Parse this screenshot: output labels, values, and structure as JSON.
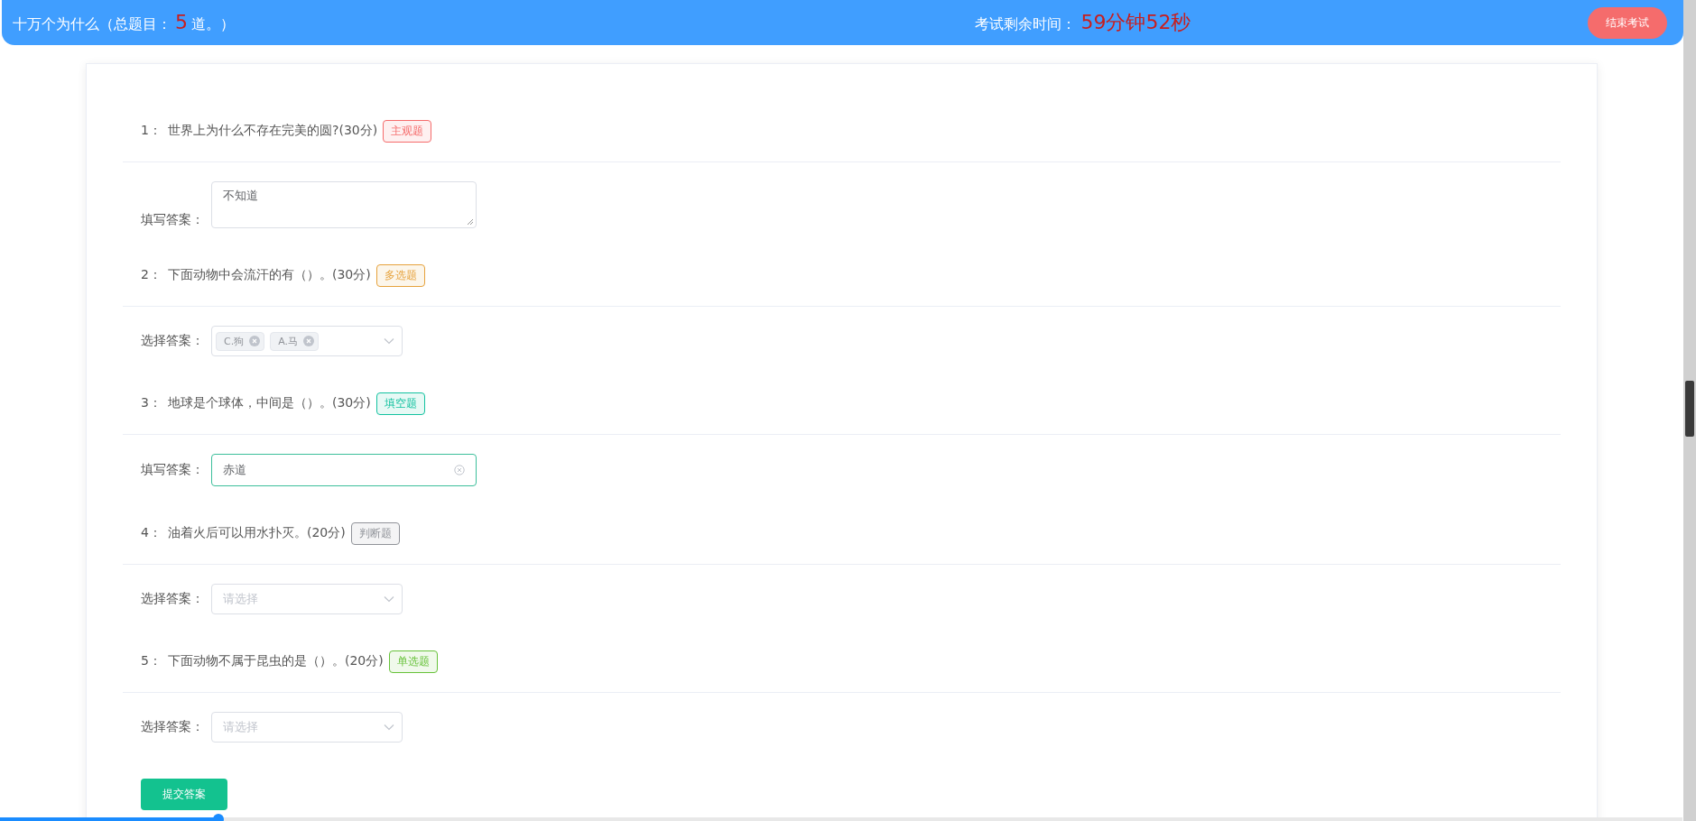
{
  "header": {
    "title_before": "十万个为什么（总题目：",
    "total": "5",
    "title_after": "道。）",
    "timer_label": "考试剩余时间：",
    "timer": "59分钟52秒",
    "end_button": "结束考试"
  },
  "questions": [
    {
      "number": "1：",
      "text": "世界上为什么不存在完美的圆?(30分)",
      "tag": {
        "label": "主观题",
        "color": "#f56c6c"
      },
      "answer": {
        "kind": "textarea",
        "label": "填写答案：",
        "value": "不知道",
        "focused": false
      }
    },
    {
      "number": "2：",
      "text": "下面动物中会流汗的有（）。(30分)",
      "tag": {
        "label": "多选题",
        "color": "#e6a23c"
      },
      "answer": {
        "kind": "multiselect",
        "label": "选择答案：",
        "chips": [
          "C.狗",
          "A.马"
        ],
        "focused": false
      }
    },
    {
      "number": "3：",
      "text": "地球是个球体，中间是（）。(30分)",
      "tag": {
        "label": "填空题",
        "color": "#13c2a0"
      },
      "answer": {
        "kind": "input",
        "label": "填写答案：",
        "value": "赤道",
        "focused": true
      }
    },
    {
      "number": "4：",
      "text": "油着火后可以用水扑灭。(20分)",
      "tag": {
        "label": "判断题",
        "color": "#909399"
      },
      "answer": {
        "kind": "select",
        "label": "选择答案：",
        "placeholder": "请选择",
        "focused": false
      }
    },
    {
      "number": "5：",
      "text": "下面动物不属于昆虫的是（）。(20分)",
      "tag": {
        "label": "单选题",
        "color": "#67c23a"
      },
      "answer": {
        "kind": "select",
        "label": "选择答案：",
        "placeholder": "请选择",
        "focused": false
      }
    }
  ],
  "submit_button": "提交答案",
  "playback_bar": {
    "level": 0.13
  }
}
